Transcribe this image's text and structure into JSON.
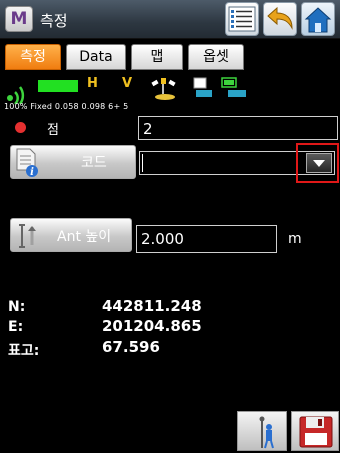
{
  "titlebar": {
    "app_icon": "M",
    "title": "측정"
  },
  "tabs": [
    {
      "label": "측정",
      "active": true
    },
    {
      "label": "Data",
      "active": false
    },
    {
      "label": "맵",
      "active": false
    },
    {
      "label": "옵셋",
      "active": false
    }
  ],
  "status": {
    "rtk_h": "H",
    "rtk_v": "V",
    "line": "100% Fixed 0.058 0.098  6+ 5"
  },
  "form": {
    "point_label": "점",
    "point_value": "2",
    "code_button": "코드",
    "code_value": "",
    "ant_button": "Ant 높이",
    "ant_value": "2.000",
    "ant_unit": "m"
  },
  "coords": {
    "n_label": "N:",
    "n_value": "442811.248",
    "e_label": "E:",
    "e_value": "201204.865",
    "h_label": "표고:",
    "h_value": "67.596"
  },
  "colors": {
    "accent": "#f07d10",
    "highlight": "#e01818",
    "point_dot": "#e53030"
  },
  "icons": [
    "list-icon",
    "back-arrow-icon",
    "home-icon",
    "signal-icon",
    "satellite-icon",
    "battery-icon",
    "info-icon",
    "antenna-height-icon",
    "rod-icon",
    "save-disk-icon"
  ]
}
